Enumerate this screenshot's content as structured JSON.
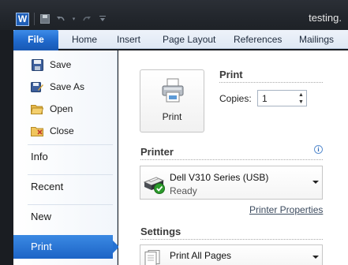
{
  "window": {
    "document_title": "testing.",
    "app_icon_letter": "W"
  },
  "ribbon": {
    "file_tab": "File",
    "tabs": [
      "Home",
      "Insert",
      "Page Layout",
      "References",
      "Mailings"
    ]
  },
  "backstage_nav": {
    "commands": [
      {
        "label": "Save",
        "icon": "save-icon"
      },
      {
        "label": "Save As",
        "icon": "save-as-icon"
      },
      {
        "label": "Open",
        "icon": "folder-open-icon"
      },
      {
        "label": "Close",
        "icon": "folder-close-icon"
      }
    ],
    "tabs": [
      "Info",
      "Recent",
      "New",
      "Print"
    ],
    "active_tab": "Print"
  },
  "print_panel": {
    "print_button_label": "Print",
    "print_section_title": "Print",
    "copies_label": "Copies:",
    "copies_value": "1",
    "printer_section_title": "Printer",
    "printer_name": "Dell V310 Series (USB)",
    "printer_status": "Ready",
    "printer_properties_link": "Printer Properties",
    "settings_section_title": "Settings",
    "settings_first_option": "Print All Pages"
  },
  "colors": {
    "accent": "#1f68cb",
    "ready_check": "#2c9b2c"
  }
}
